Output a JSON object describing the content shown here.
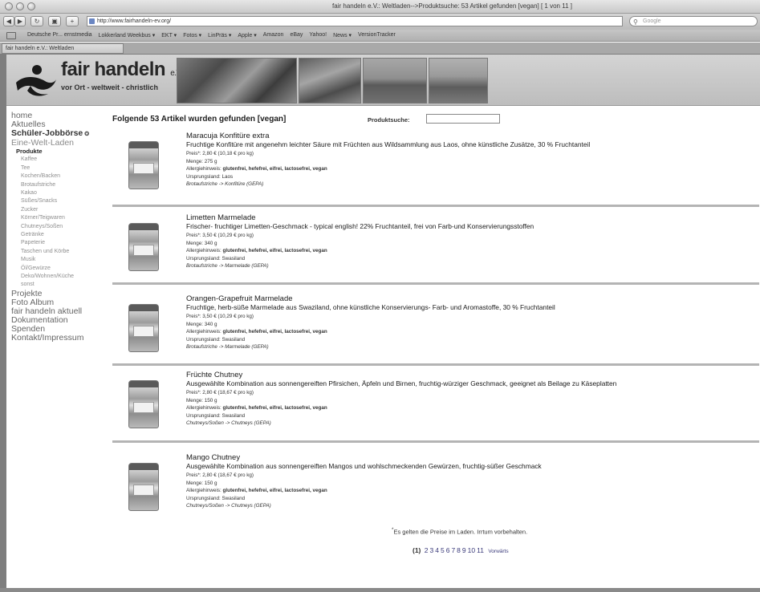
{
  "browser": {
    "window_title": "fair handeln e.V.: Weltladen-->Produktsuche: 53 Artikel gefunden [vegan] [ 1 von 11 ]",
    "url": "http://www.fairhandeln-ev.org/",
    "search_placeholder": "Google",
    "tab_label": "fair handeln e.V.: Weltladen",
    "bookmarks": [
      "Deutsche Pr... ernstmedia",
      "Lokkerland Weekbus ▾",
      "EKT ▾",
      "Fotos ▾",
      "LinPräs ▾",
      "Apple ▾",
      "Amazon",
      "eBay",
      "Yahoo!",
      "News ▾",
      "VersionTracker"
    ]
  },
  "site": {
    "logo_name": "fair handeln",
    "logo_suffix": "e.V.",
    "tagline": "vor Ort - weltweit - christlich"
  },
  "sidebar": {
    "home": "home",
    "aktuelles": "Aktuelles",
    "schueler": "Schüler-Jobbörse",
    "eine_welt": "Eine-Welt-Laden",
    "produkte": "Produkte",
    "categories": [
      "Kaffee",
      "Tee",
      "Kochen/Backen",
      "Brotaufstriche",
      "Kakao",
      "Süßes/Snacks",
      "Zucker",
      "Körner/Teigwaren",
      "Chutneys/Soßen",
      "Getränke",
      "Papeterie",
      "Taschen und Körbe",
      "Musik",
      "Öl/Gewürze",
      "Deko/Wohnen/Küche",
      "sonst"
    ],
    "bottom_items": [
      "Projekte",
      "Foto Album",
      "fair handeln aktuell",
      "Dokumentation",
      "Spenden",
      "Kontakt/Impressum"
    ]
  },
  "results": {
    "heading": "Folgende 53 Artikel wurden gefunden [vegan]",
    "search_label": "Produktsuche:",
    "search_value": ""
  },
  "products": [
    {
      "title": "Maracuja Konfitüre extra",
      "description": "Fruchtige Konfitüre mit angenehm leichter Säure mit Früchten aus Wildsammlung aus Laos, ohne künstliche Zusätze, 30 % Fruchtanteil",
      "price": "Preis*: 2,80 € (10,18 € pro kg)",
      "amount": "Menge: 275 g",
      "allergy_label": "Allergiehinweis:",
      "allergy": "glutenfrei, hefefrei, eifrei, lactosefrei, vegan",
      "origin": "Ursprungsland: Laos",
      "category": "Brotaufstriche -> Konfitüre (GEPA)"
    },
    {
      "title": "Limetten Marmelade",
      "description": "Frischer- fruchtiger Limetten-Geschmack - typical english! 22% Fruchtanteil, frei von Farb-und Konservierungsstoffen",
      "price": "Preis*: 3,50 € (10,29 € pro kg)",
      "amount": "Menge: 340 g",
      "allergy_label": "Allergiehinweis:",
      "allergy": "glutenfrei, hefefrei, eifrei, lactosefrei, vegan",
      "origin": "Ursprungsland: Swasiland",
      "category": "Brotaufstriche -> Marmelade (GEPA)"
    },
    {
      "title": "Orangen-Grapefruit Marmelade",
      "description": "Fruchtige, herb-süße Marmelade aus Swaziland, ohne künstliche Konservierungs- Farb- und Aromastoffe, 30 % Fruchtanteil",
      "price": "Preis*: 3,50 € (10,29 € pro kg)",
      "amount": "Menge: 340 g",
      "allergy_label": "Allergiehinweis:",
      "allergy": "glutenfrei, hefefrei, eifrei, lactosefrei, vegan",
      "origin": "Ursprungsland: Swasiland",
      "category": "Brotaufstriche -> Marmelade (GEPA)"
    },
    {
      "title": "Früchte Chutney",
      "description": "Ausgewählte Kombination aus sonnengereiften Pfirsichen, Äpfeln und Birnen, fruchtig-würziger Geschmack, geeignet als Beilage zu Käseplatten",
      "price": "Preis*: 2,80 € (18,67 € pro kg)",
      "amount": "Menge: 150 g",
      "allergy_label": "Allergiehinweis:",
      "allergy": "glutenfrei, hefefrei, eifrei, lactosefrei, vegan",
      "origin": "Ursprungsland: Swasiland",
      "category": "Chutneys/Soßen -> Chutneys (GEPA)"
    },
    {
      "title": "Mango Chutney",
      "description": "Ausgewählte Kombination aus sonnengereiften Mangos und wohlschmeckenden Gewürzen, fruchtig-süßer Geschmack",
      "price": "Preis*: 2,80 € (18,67 € pro kg)",
      "amount": "Menge: 150 g",
      "allergy_label": "Allergiehinweis:",
      "allergy": "glutenfrei, hefefrei, eifrei, lactosefrei, vegan",
      "origin": "Ursprungsland: Swasiland",
      "category": "Chutneys/Soßen -> Chutneys (GEPA)"
    }
  ],
  "footer": {
    "footnote_mark": "*",
    "footnote": "Es gelten die Preise im Laden. Irrtum vorbehalten.",
    "current_page": "(1)",
    "pages": [
      "2",
      "3",
      "4",
      "5",
      "6",
      "7",
      "8",
      "9",
      "10",
      "11"
    ],
    "next_label": "Vorwärts"
  }
}
